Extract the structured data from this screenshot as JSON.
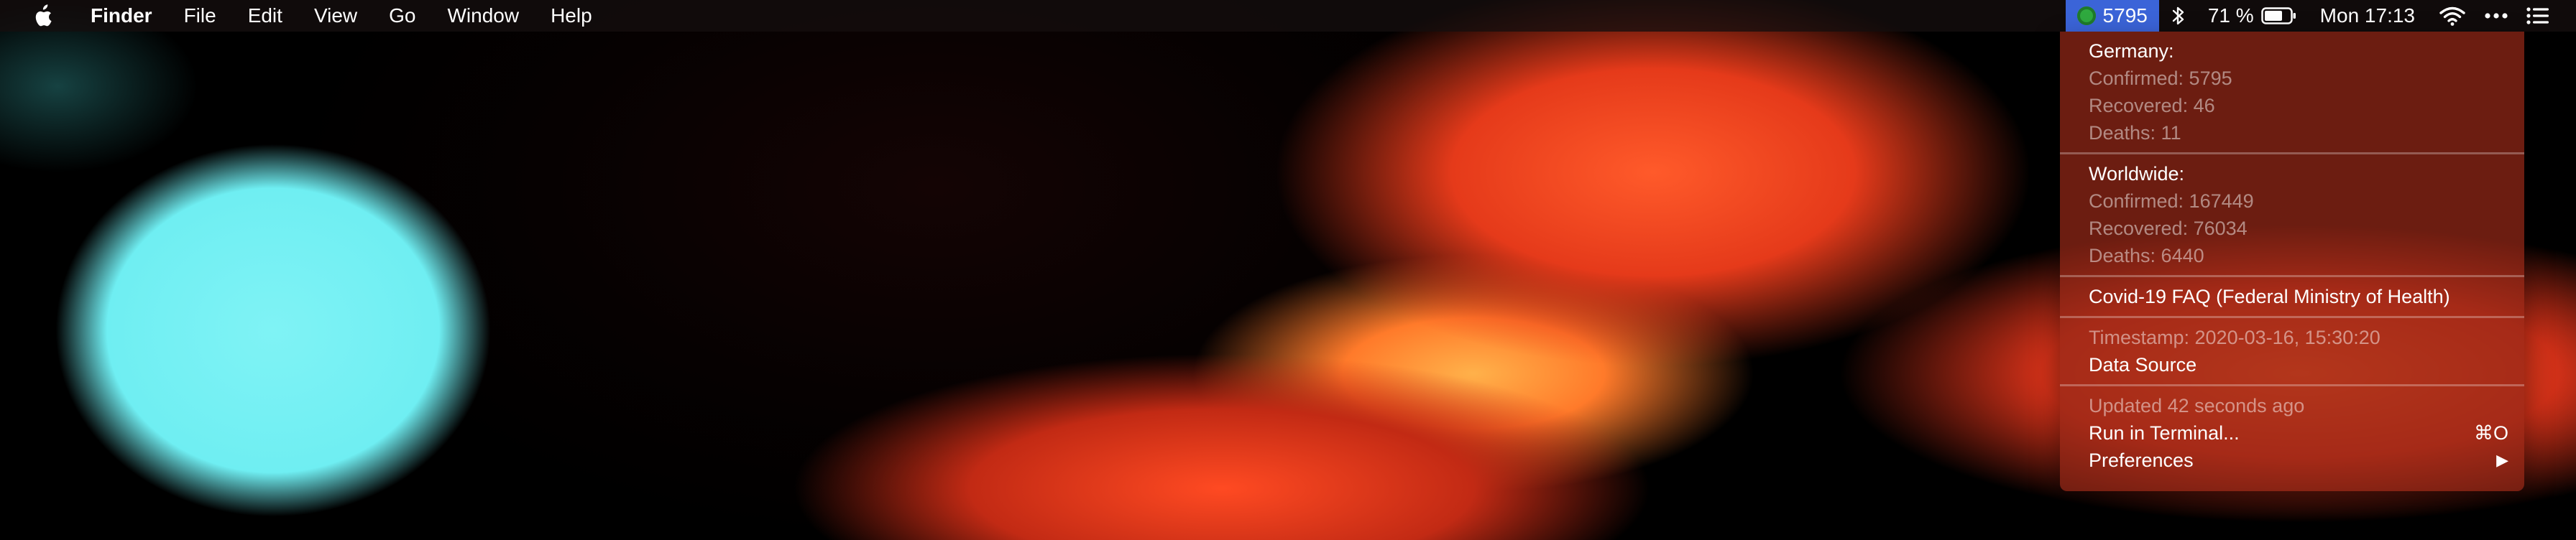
{
  "menubar": {
    "apple_icon": "apple-logo-icon",
    "app_name": "Finder",
    "menus": [
      "File",
      "Edit",
      "View",
      "Go",
      "Window",
      "Help"
    ]
  },
  "status": {
    "covid_count": "5795",
    "battery_percent": "71 %",
    "clock": "Mon 17:13",
    "icons": [
      "covid-status-icon",
      "bluetooth-icon",
      "battery-icon",
      "wifi-icon",
      "more-icon",
      "notification-center-icon"
    ]
  },
  "dropdown": {
    "germany": {
      "heading": "Germany:",
      "confirmed": "Confirmed: 5795",
      "recovered": "Recovered: 46",
      "deaths": "Deaths: 11"
    },
    "worldwide": {
      "heading": "Worldwide:",
      "confirmed": "Confirmed: 167449",
      "recovered": "Recovered: 76034",
      "deaths": "Deaths: 6440"
    },
    "faq": "Covid-19 FAQ (Federal Ministry of Health)",
    "timestamp": "Timestamp: 2020-03-16, 15:30:20",
    "data_source": "Data Source",
    "updated": "Updated 42 seconds ago",
    "run_terminal": "Run in Terminal...",
    "run_terminal_shortcut": "⌘O",
    "preferences": "Preferences",
    "preferences_arrow": "▶"
  },
  "colors": {
    "menubar_bg": "#1a1111",
    "status_highlight": "#3b64d8",
    "dropdown_bg": "#962818",
    "wallpaper_cyan": "#7ff3f5",
    "wallpaper_orange": "#ff5a2a"
  }
}
